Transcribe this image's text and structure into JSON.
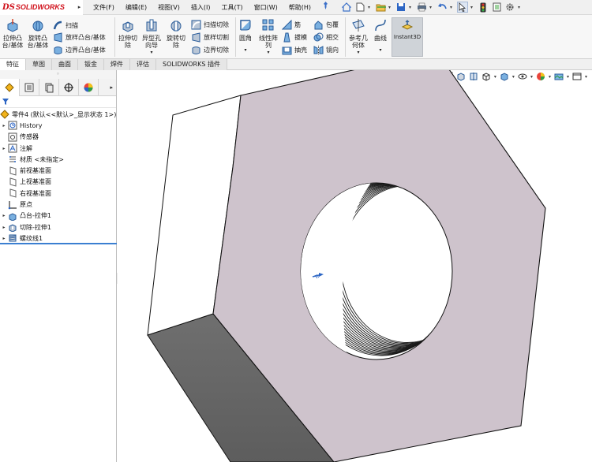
{
  "app": {
    "logo_ds": "DS",
    "logo_name": "SOLIDWORKS"
  },
  "menu": [
    {
      "label": "文件(F)"
    },
    {
      "label": "编辑(E)"
    },
    {
      "label": "视图(V)"
    },
    {
      "label": "插入(I)"
    },
    {
      "label": "工具(T)"
    },
    {
      "label": "窗口(W)"
    },
    {
      "label": "帮助(H)"
    }
  ],
  "ribbon": {
    "extrude_boss": "拉伸凸\n台/基体",
    "revolve_boss": "旋转凸\n台/基体",
    "sweep": "扫描",
    "loft_boss": "放样凸台/基体",
    "boundary_boss": "边界凸台/基体",
    "extrude_cut": "拉伸切\n除",
    "hole_wizard": "异型孔\n向导",
    "revolve_cut": "旋转切\n除",
    "sweep_cut": "扫描切除",
    "loft_cut": "放样切割",
    "boundary_cut": "边界切除",
    "fillet": "圆角",
    "linear_pattern": "线性阵\n列",
    "rib": "筋",
    "draft": "拔模",
    "shell": "抽壳",
    "wrap": "包覆",
    "intersect": "相交",
    "mirror": "镜向",
    "ref_geometry": "参考几\n何体",
    "curves": "曲线",
    "instant3d": "Instant3D"
  },
  "tabs": [
    {
      "label": "特征",
      "active": true
    },
    {
      "label": "草图",
      "active": false
    },
    {
      "label": "曲面",
      "active": false
    },
    {
      "label": "钣金",
      "active": false
    },
    {
      "label": "焊件",
      "active": false
    },
    {
      "label": "评估",
      "active": false
    },
    {
      "label": "SOLIDWORKS 插件",
      "active": false
    }
  ],
  "tree": {
    "root": "零件4  (默认<<默认>_显示状态 1>)",
    "items": [
      {
        "label": "History",
        "expandable": true,
        "icon": "history-icon"
      },
      {
        "label": "传感器",
        "expandable": false,
        "icon": "sensor-icon"
      },
      {
        "label": "注解",
        "expandable": true,
        "icon": "annotation-icon"
      },
      {
        "label": "材质 <未指定>",
        "expandable": false,
        "icon": "material-icon"
      },
      {
        "label": "前视基准面",
        "expandable": false,
        "icon": "plane-icon"
      },
      {
        "label": "上视基准面",
        "expandable": false,
        "icon": "plane-icon"
      },
      {
        "label": "右视基准面",
        "expandable": false,
        "icon": "plane-icon"
      },
      {
        "label": "原点",
        "expandable": false,
        "icon": "origin-icon"
      },
      {
        "label": "凸台-拉伸1",
        "expandable": true,
        "icon": "extrude-icon"
      },
      {
        "label": "切除-拉伸1",
        "expandable": true,
        "icon": "cut-icon"
      },
      {
        "label": "螺纹线1",
        "expandable": true,
        "icon": "thread-icon"
      }
    ]
  },
  "colors": {
    "face_front": "#cec3cc",
    "face_left": "#ffffff",
    "face_bottom": "#6a6a6a",
    "edge": "#111111",
    "accent": "#3b7fd1"
  }
}
